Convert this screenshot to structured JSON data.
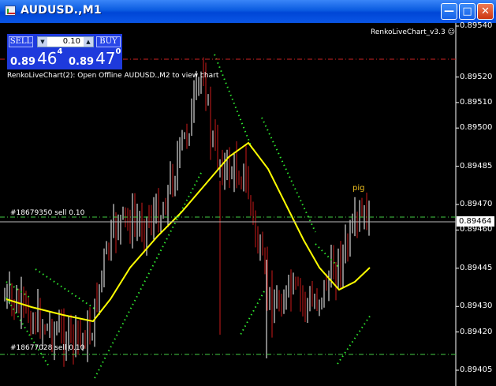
{
  "window": {
    "title": "AUDUSD.,M1"
  },
  "trade_panel": {
    "sell_label": "SELL",
    "buy_label": "BUY",
    "lot": "0.10",
    "sell_prefix": "0.89",
    "sell_big": "46",
    "sell_pip": "4",
    "buy_prefix": "0.89",
    "buy_big": "47",
    "buy_pip": "0"
  },
  "chart": {
    "indicator_name": "RenkoLiveChart_v3.3",
    "message": "RenkoLiveChart(2): Open Offline AUDUSD.,M2 to view chart",
    "order1_label": "#18679350 sell 0.10",
    "order2_label": "#18677028 sell 0.10",
    "annotation": "pig",
    "current_price": "0.89464",
    "price_ticks": [
      "0.89540",
      "0.89520",
      "0.89510",
      "0.89500",
      "0.89485",
      "0.89470",
      "0.89460",
      "0.89445",
      "0.89430",
      "0.89420",
      "0.89405"
    ],
    "colors": {
      "bull": "#ffffff",
      "bear": "#cc1a1a",
      "ma": "#ffff00",
      "dots": "#2ee82e",
      "order_line": "#44cc44",
      "red_line": "#cc2222",
      "grid": "#ffffff"
    }
  }
}
